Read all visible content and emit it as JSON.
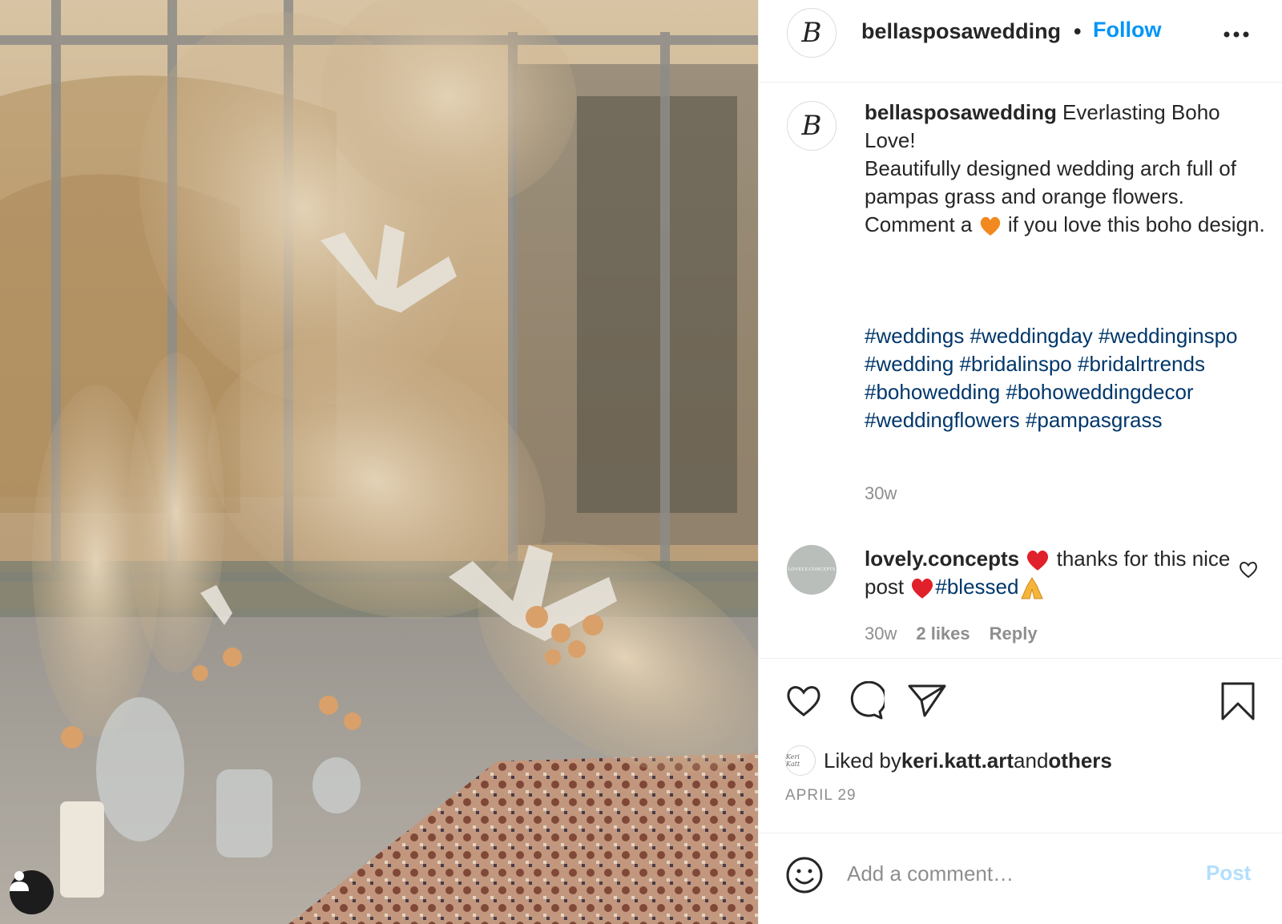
{
  "post": {
    "author": "bellasposawedding",
    "separator": "•",
    "follow_label": "Follow",
    "more_icon": "more-options-icon",
    "avatar_monogram": "B"
  },
  "caption": {
    "username": "bellasposawedding",
    "line1": " Everlasting Boho Love!",
    "line2": "Beautifully designed wedding arch full of pampas grass and orange flowers.",
    "line3_before": "Comment a ",
    "emoji": "orange-heart-icon",
    "line3_after": " if you love this boho design.",
    "hashtags": [
      "#weddings",
      "#weddingday",
      "#weddinginspo",
      "#wedding",
      "#bridalinspo",
      "#bridalrtrends",
      "#bohowedding",
      "#bohoweddingdecor",
      "#weddingflowers",
      "#pampasgrass"
    ],
    "time": "30w"
  },
  "comment": {
    "username": "lovely.concepts",
    "avatar_text": "LOVELY.CONCEPTS",
    "text_before": " thanks for this nice post ",
    "hashtag": "#blessed",
    "time": "30w",
    "likes": "2 likes",
    "reply_label": "Reply"
  },
  "likes": {
    "prefix": "Liked by ",
    "user": "keri.katt.art",
    "middle": " and ",
    "others": "others",
    "avatar_text": "Keri Katt"
  },
  "date": "APRIL 29",
  "add_comment": {
    "placeholder": "Add a comment…",
    "post_label": "Post"
  },
  "colors": {
    "link_blue": "#0095f6",
    "hashtag_blue": "#00376b",
    "muted": "#8e8e8e",
    "disabled_blue": "#b2dffc",
    "heart_red": "#e0202a",
    "orange_heart": "#f2891f"
  }
}
